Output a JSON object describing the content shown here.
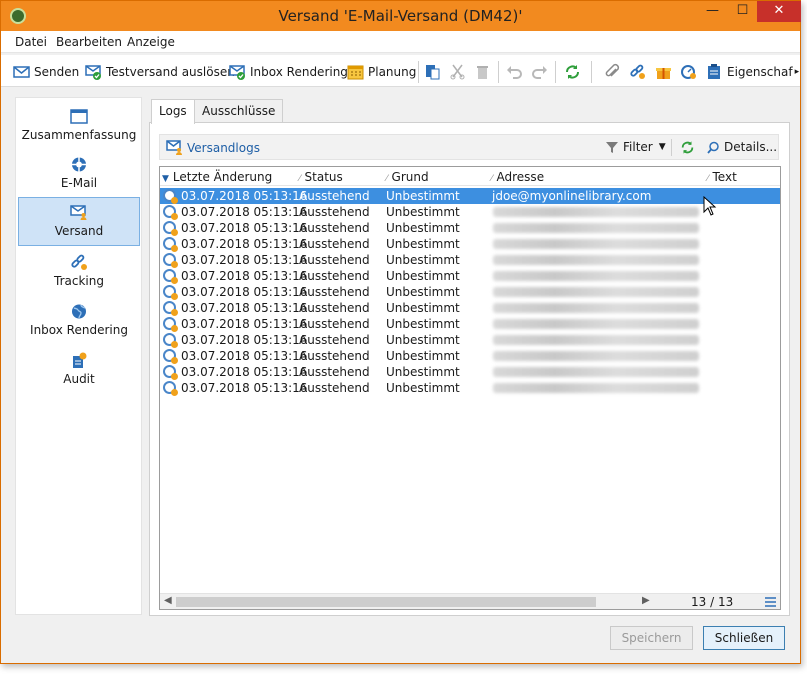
{
  "window": {
    "title": "Versand 'E-Mail-Versand (DM42)'",
    "min": "—",
    "max": "☐",
    "close": "✕"
  },
  "menu": [
    "Datei",
    "Bearbeiten",
    "Anzeige"
  ],
  "toolbar": {
    "senden": "Senden",
    "testversand": "Testversand auslösen",
    "inbox": "Inbox Rendering",
    "planung": "Planung",
    "eigenschaften": "Eigenschaf",
    "more": "▸"
  },
  "sidebar": [
    {
      "label": "Zusammenfassung"
    },
    {
      "label": "E-Mail"
    },
    {
      "label": "Versand"
    },
    {
      "label": "Tracking"
    },
    {
      "label": "Inbox Rendering"
    },
    {
      "label": "Audit"
    }
  ],
  "tabs": [
    "Logs",
    "Ausschlüsse"
  ],
  "subtoolbar": {
    "versandlogs": "Versandlogs",
    "filter": "Filter",
    "details": "Details..."
  },
  "grid": {
    "columns": [
      "Letzte Änderung",
      "Status",
      "Grund",
      "Adresse",
      "Text"
    ],
    "rows": [
      {
        "date": "03.07.2018 05:13:16",
        "status": "Ausstehend",
        "grund": "Unbestimmt",
        "adresse": "jdoe@myonlinelibrary.com"
      },
      {
        "date": "03.07.2018 05:13:16",
        "status": "Ausstehend",
        "grund": "Unbestimmt",
        "adresse": ""
      },
      {
        "date": "03.07.2018 05:13:16",
        "status": "Ausstehend",
        "grund": "Unbestimmt",
        "adresse": ""
      },
      {
        "date": "03.07.2018 05:13:16",
        "status": "Ausstehend",
        "grund": "Unbestimmt",
        "adresse": ""
      },
      {
        "date": "03.07.2018 05:13:16",
        "status": "Ausstehend",
        "grund": "Unbestimmt",
        "adresse": ""
      },
      {
        "date": "03.07.2018 05:13:16",
        "status": "Ausstehend",
        "grund": "Unbestimmt",
        "adresse": ""
      },
      {
        "date": "03.07.2018 05:13:16",
        "status": "Ausstehend",
        "grund": "Unbestimmt",
        "adresse": ""
      },
      {
        "date": "03.07.2018 05:13:16",
        "status": "Ausstehend",
        "grund": "Unbestimmt",
        "adresse": ""
      },
      {
        "date": "03.07.2018 05:13:16",
        "status": "Ausstehend",
        "grund": "Unbestimmt",
        "adresse": ""
      },
      {
        "date": "03.07.2018 05:13:16",
        "status": "Ausstehend",
        "grund": "Unbestimmt",
        "adresse": ""
      },
      {
        "date": "03.07.2018 05:13:16",
        "status": "Ausstehend",
        "grund": "Unbestimmt",
        "adresse": ""
      },
      {
        "date": "03.07.2018 05:13:16",
        "status": "Ausstehend",
        "grund": "Unbestimmt",
        "adresse": ""
      },
      {
        "date": "03.07.2018 05:13:16",
        "status": "Ausstehend",
        "grund": "Unbestimmt",
        "adresse": ""
      }
    ],
    "count": "13 / 13"
  },
  "buttons": {
    "speichern": "Speichern",
    "schliessen": "Schließen"
  },
  "colors": {
    "titlebar": "#f28a1f",
    "selection": "#3d8fe0",
    "link": "#1f5fa6",
    "green": "#2e9e3a"
  }
}
